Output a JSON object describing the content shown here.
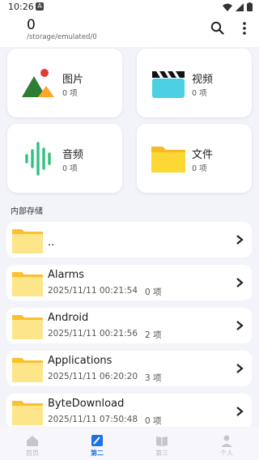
{
  "status_bar": {
    "time": "10:26",
    "notif_letter": "A"
  },
  "header": {
    "title": "0",
    "path": "/storage/emulated/0"
  },
  "categories": [
    {
      "label": "图片",
      "count": "0 项",
      "icon": "image-icon"
    },
    {
      "label": "视频",
      "count": "0 项",
      "icon": "clapperboard-icon"
    },
    {
      "label": "音频",
      "count": "0 项",
      "icon": "soundwave-icon"
    },
    {
      "label": "文件",
      "count": "0 项",
      "icon": "folder-icon"
    }
  ],
  "section": {
    "title": "内部存储"
  },
  "files": [
    {
      "name": "..",
      "date": "",
      "count": ""
    },
    {
      "name": "Alarms",
      "date": "2025/11/11 00:21:54",
      "count": "0 项"
    },
    {
      "name": "Android",
      "date": "2025/11/11 00:21:56",
      "count": "2 项"
    },
    {
      "name": "Applications",
      "date": "2025/11/11 06:20:20",
      "count": "3 项"
    },
    {
      "name": "ByteDownload",
      "date": "2025/11/11 07:50:48",
      "count": "0 项"
    }
  ],
  "nav": [
    {
      "label": "首页"
    },
    {
      "label": "第二"
    },
    {
      "label": "第三"
    },
    {
      "label": "个人"
    }
  ],
  "colors": {
    "accent": "#1a73e8",
    "folder": "#fdd835",
    "audio": "#2ec27e",
    "video": "#4dd0e1"
  }
}
